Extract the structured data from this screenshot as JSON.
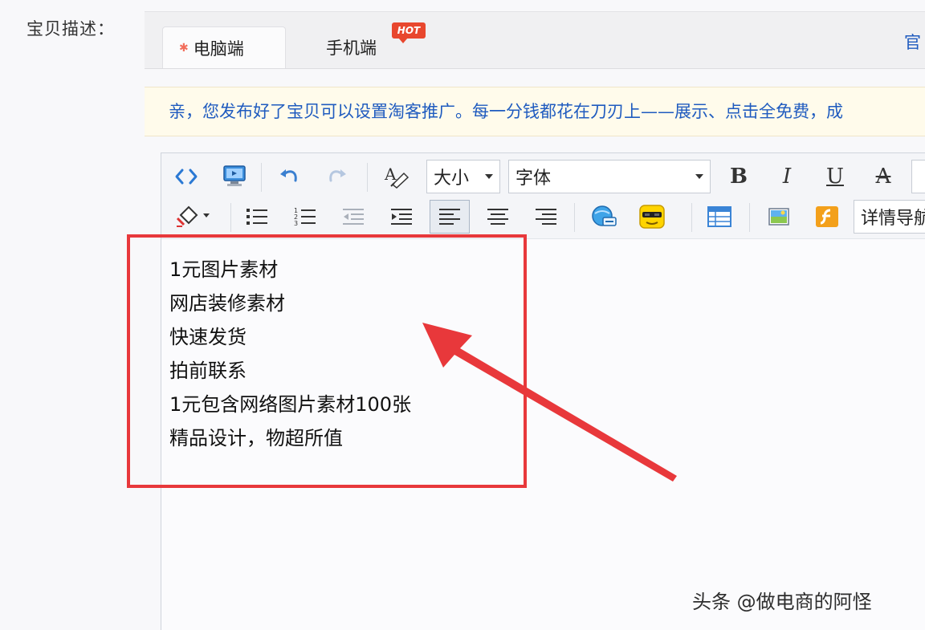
{
  "field_label": "宝贝描述：",
  "tabs": [
    {
      "label": "电脑端",
      "active": true
    },
    {
      "label": "手机端",
      "badge": "HOT"
    }
  ],
  "official_link": "官",
  "notice_text": "亲，您发布好了宝贝可以设置淘客推广。每一分钱都花在刀刃上——展示、点击全免费，成",
  "toolbar": {
    "size_select": "大小",
    "font_select": "字体",
    "bold_label": "B",
    "italic_label": "I",
    "underline_label": "U",
    "strike_label": "A",
    "detail_nav": "详情导航",
    "icons": [
      "source-code-icon",
      "preview-icon",
      "undo-icon",
      "redo-icon",
      "format-painter-icon",
      "fill-color-icon",
      "bullet-list-icon",
      "numbered-list-icon",
      "outdent-icon",
      "indent-icon",
      "align-left-icon",
      "align-center-icon",
      "align-right-icon",
      "link-icon",
      "emoticon-icon",
      "table-icon",
      "image-icon",
      "flash-icon"
    ]
  },
  "content_lines": [
    "1元图片素材",
    "网店装修素材",
    "快速发货",
    "拍前联系",
    "1元包含网络图片素材100张",
    "精品设计，物超所值"
  ],
  "watermark": "头条 @做电商的阿怪",
  "colors": {
    "link_blue": "#1f5bbf",
    "annotation_red": "#e8383b",
    "hot_badge": "#e8472e",
    "notice_bg": "#fffbeb"
  }
}
